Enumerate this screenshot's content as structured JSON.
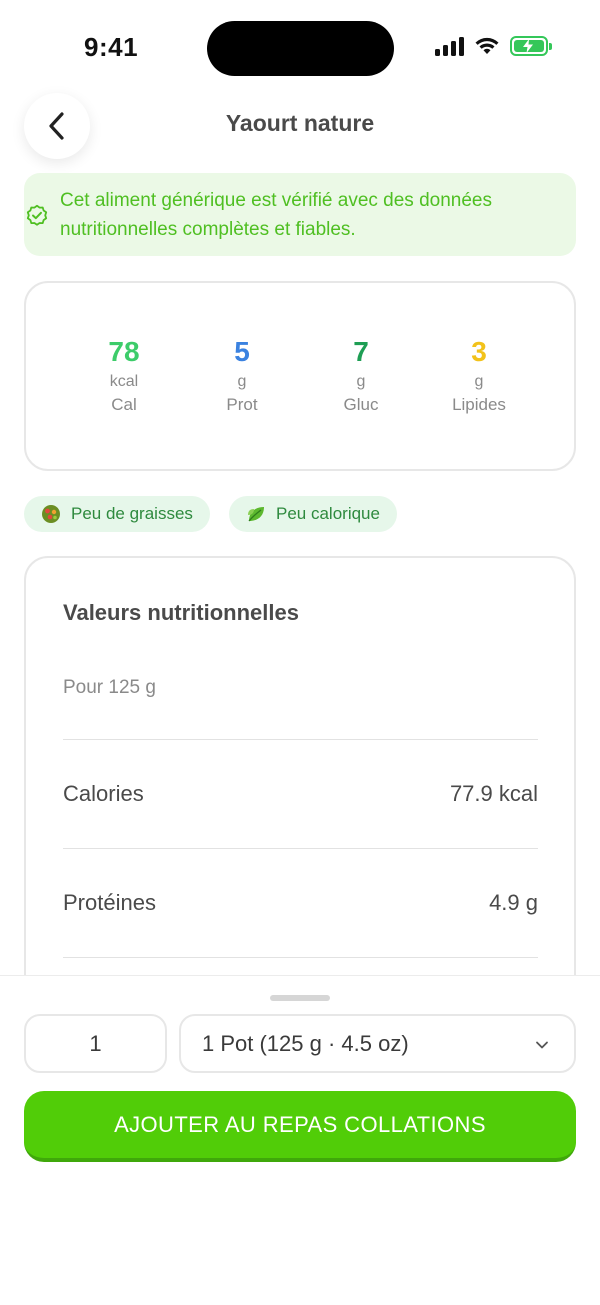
{
  "status_bar": {
    "time": "9:41"
  },
  "header": {
    "title": "Yaourt nature"
  },
  "verified_banner": {
    "text": "Cet aliment générique est vérifié avec des données nutritionnelles complètes et fiables."
  },
  "macros": [
    {
      "value": "78",
      "unit": "kcal",
      "label": "Cal",
      "color": "#3dcc6a"
    },
    {
      "value": "5",
      "unit": "g",
      "label": "Prot",
      "color": "#3b82e0"
    },
    {
      "value": "7",
      "unit": "g",
      "label": "Gluc",
      "color": "#1e9e54"
    },
    {
      "value": "3",
      "unit": "g",
      "label": "Lipides",
      "color": "#f2c21a"
    }
  ],
  "tags": [
    {
      "label": "Peu de graisses",
      "icon": "salad-icon"
    },
    {
      "label": "Peu calorique",
      "icon": "leaf-icon"
    }
  ],
  "nutrition": {
    "title": "Valeurs nutritionnelles",
    "per": "Pour 125 g",
    "rows": [
      {
        "label": "Calories",
        "value": "77.9 kcal"
      },
      {
        "label": "Protéines",
        "value": "4.9 g"
      }
    ]
  },
  "bottom_sheet": {
    "quantity": "1",
    "serving": "1 Pot (125 g · 4.5 oz)",
    "add_button": "AJOUTER AU REPAS COLLATIONS"
  },
  "colors": {
    "accent": "#51cd08",
    "banner_bg": "#ebf9e6",
    "banner_text": "#4fbf22",
    "tag_bg": "#e6f7ea",
    "tag_text": "#2e8a3e"
  }
}
